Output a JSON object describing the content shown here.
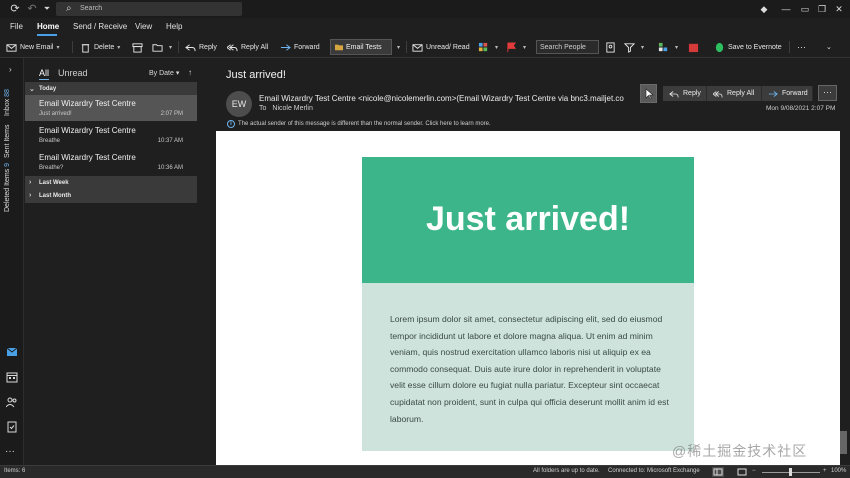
{
  "titlebar": {
    "search_placeholder": "Search",
    "sync_icon": "sync-icon",
    "undo_icon": "undo-icon"
  },
  "menu": [
    "File",
    "Home",
    "Send / Receive",
    "View",
    "Help"
  ],
  "ribbon": {
    "new_email": "New Email",
    "delete": "Delete",
    "reply": "Reply",
    "reply_all": "Reply All",
    "forward": "Forward",
    "email_tests": "Email Tests",
    "unread_read": "Unread/ Read",
    "search_people": "Search People",
    "save_evernote": "Save to Evernote"
  },
  "rail": {
    "inbox_label": "Inbox",
    "inbox_count": "88",
    "sent_label": "Sent Items",
    "deleted_label": "Deleted Items",
    "deleted_count": "9"
  },
  "message_list": {
    "tab_all": "All",
    "tab_unread": "Unread",
    "sort": "By Date",
    "groups": [
      {
        "label": "Today",
        "messages": [
          {
            "sender": "Email Wizardry Test Centre",
            "subject": "Just arrived!",
            "time": "2:07 PM",
            "selected": true
          },
          {
            "sender": "Email Wizardry Test Centre",
            "subject": "Breathe",
            "time": "10:37 AM",
            "selected": false
          },
          {
            "sender": "Email Wizardry Test Centre",
            "subject": "Breathe?",
            "time": "10:36 AM",
            "selected": false
          }
        ]
      },
      {
        "label": "Last Week"
      },
      {
        "label": "Last Month"
      }
    ]
  },
  "reading": {
    "subject": "Just arrived!",
    "avatar_initials": "EW",
    "from": "Email Wizardry Test Centre <nicole@nicolemerlin.com>(Email Wizardry Test Centre via bnc3.mailjet.co",
    "to_label": "To",
    "to_name": "Nicole Merlin",
    "info": "The actual sender of this message is different than the normal sender. Click here to learn more.",
    "reply": "Reply",
    "reply_all": "Reply All",
    "forward": "Forward",
    "more": "···",
    "date": "Mon 9/08/2021 2:07 PM",
    "hero_title": "Just arrived!",
    "body_text": "Lorem ipsum dolor sit amet, consectetur adipiscing elit, sed do eiusmod tempor incididunt ut labore et dolore magna aliqua. Ut enim ad minim veniam, quis nostrud exercitation ullamco laboris nisi ut aliquip ex ea commodo consequat. Duis aute irure dolor in reprehenderit in voluptate velit esse cillum dolore eu fugiat nulla pariatur. Excepteur sint occaecat cupidatat non proident, sunt in culpa qui officia deserunt mollit anim id est laborum."
  },
  "status": {
    "items": "Items: 6",
    "folders": "All folders are up to date.",
    "connected": "Connected to: Microsoft Exchange",
    "zoom": "100%"
  },
  "watermark": "@稀土掘金技术社区",
  "colors": {
    "hero_green": "#3db58b",
    "panel_mint": "#cde3dc",
    "accent_blue": "#4aa0e6"
  }
}
